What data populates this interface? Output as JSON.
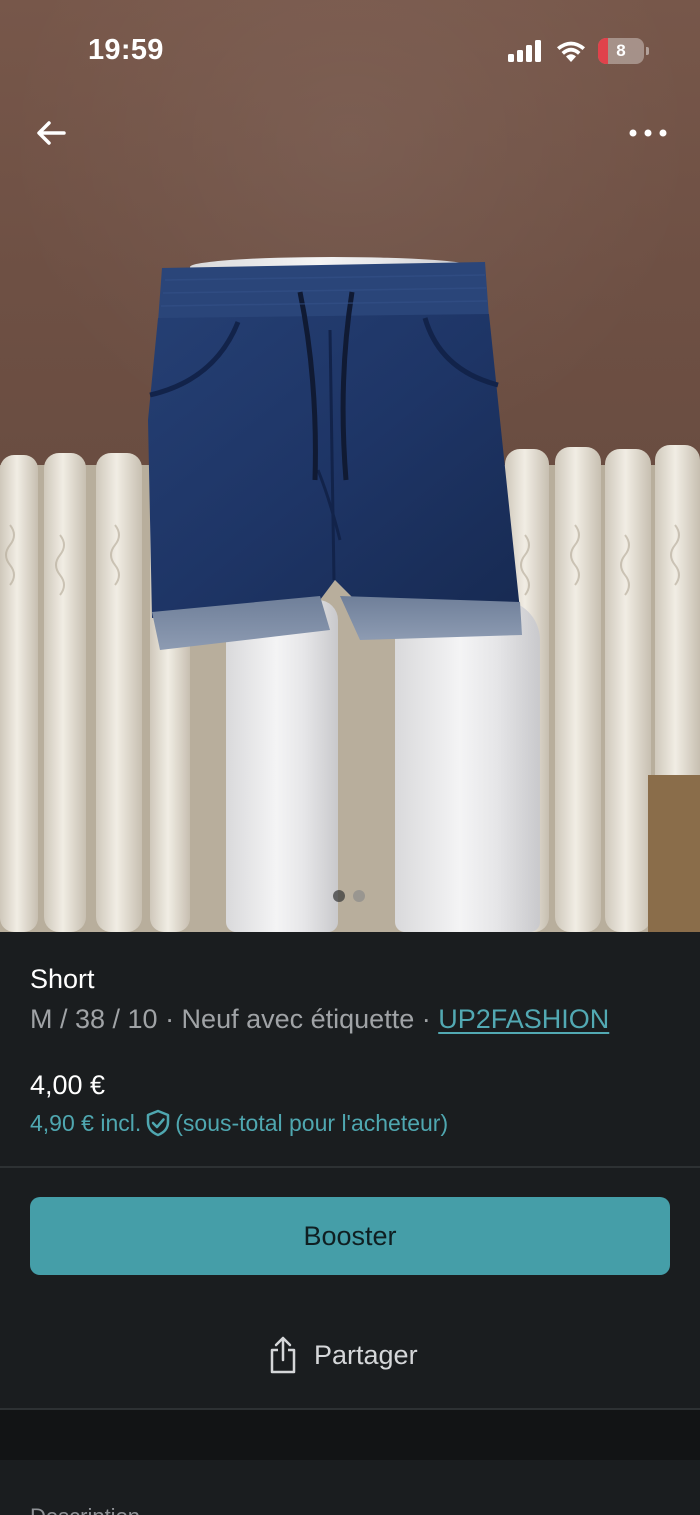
{
  "status_bar": {
    "time": "19:59",
    "battery_level": "8",
    "icons": [
      "signal-icon",
      "wifi-icon",
      "battery-icon"
    ]
  },
  "navigation": {
    "back_icon": "arrow-left-icon",
    "more_icon": "more-dots-icon"
  },
  "carousel": {
    "total_images": 2,
    "active_index": 0
  },
  "item": {
    "title": "Short",
    "details": "M / 38 / 10 · Neuf avec étiquette · ",
    "brand": "UP2FASHION",
    "price": "4,00 €",
    "price_incl_prefix": "4,90 € incl.",
    "price_incl_suffix": "(sous-total pour l'acheteur)"
  },
  "actions": {
    "booster_label": "Booster",
    "share_label": "Partager"
  },
  "description": {
    "label": "Description"
  },
  "colors": {
    "accent": "#459ea8",
    "link": "#52a9b3",
    "background": "#1a1d1f",
    "battery_low": "#e0424b"
  }
}
